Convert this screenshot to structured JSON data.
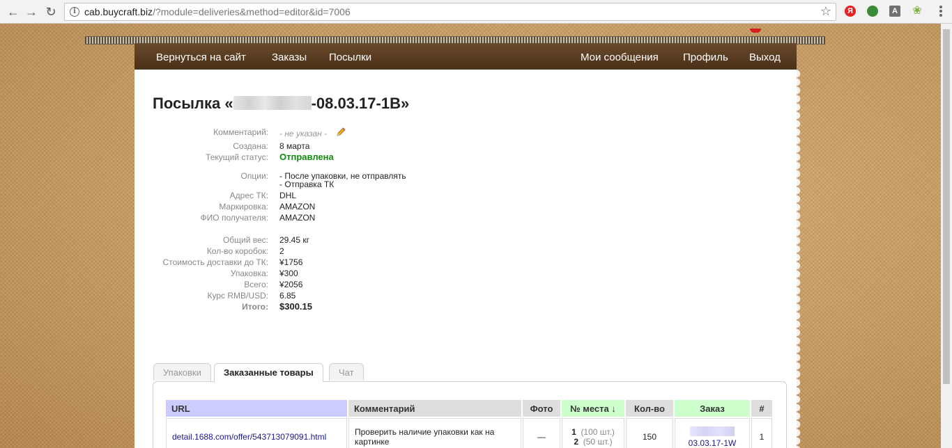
{
  "browser": {
    "url_host": "cab.buycraft.biz",
    "url_path": "/?module=deliveries&method=editor&id=7006",
    "extensions": [
      {
        "icon": "yandex-icon",
        "label": "Я",
        "color": "#e62222"
      },
      {
        "icon": "globe-icon",
        "label": "",
        "color": "#3a8a3a"
      },
      {
        "icon": "translate-icon",
        "label": "A",
        "color": "#6f6f6f"
      },
      {
        "icon": "sprout-icon",
        "label": "",
        "color": "#7ab23c"
      }
    ]
  },
  "nav": {
    "left": [
      "Вернуться на сайт",
      "Заказы",
      "Посылки"
    ],
    "right": [
      "Мои сообщения",
      "Профиль",
      "Выход"
    ]
  },
  "parcel": {
    "title_prefix": "Посылка «",
    "title_suffix": "-08.03.17-1B»",
    "fields": {
      "comment_label": "Комментарий:",
      "comment_value": "- не указан -",
      "created_label": "Создана:",
      "created_value": "8 марта",
      "status_label": "Текущий статус:",
      "status_value": "Отправлена",
      "options_label": "Опции:",
      "options_value_1": "- После упаковки, не отправлять",
      "options_value_2": "- Отправка ТК",
      "address_label": "Адрес ТК:",
      "address_value": "DHL",
      "marking_label": "Маркировка:",
      "marking_value": "AMAZON",
      "recipient_label": "ФИО получателя:",
      "recipient_value": "AMAZON",
      "weight_label": "Общий вес:",
      "weight_value": "29.45 кг",
      "boxes_label": "Кол-во коробок:",
      "boxes_value": "2",
      "shipping_label": "Стоимость доставки до ТК:",
      "shipping_value": "¥1756",
      "packing_label": "Упаковка:",
      "packing_value": "¥300",
      "total_label": "Всего:",
      "total_value": "¥2056",
      "rate_label": "Курс RMB/USD:",
      "rate_value": "6.85",
      "grand_label": "Итого:",
      "grand_value": "$300.15"
    }
  },
  "tabs": [
    "Упаковки",
    "Заказанные товары",
    "Чат"
  ],
  "table": {
    "headers": [
      "URL",
      "Комментарий",
      "Фото",
      "№ места ↓",
      "Кол-во",
      "Заказ",
      "#"
    ],
    "row": {
      "url": "detail.1688.com/offer/543713079091.html",
      "comment": "Проверить наличие упаковки как на картинке",
      "photo": "—",
      "place1_num": "1",
      "place1_qty": "(100 шт.)",
      "place2_num": "2",
      "place2_qty": "(50 шт.)",
      "qty": "150",
      "order_suffix": "03.03.17-1W",
      "index": "1"
    }
  }
}
